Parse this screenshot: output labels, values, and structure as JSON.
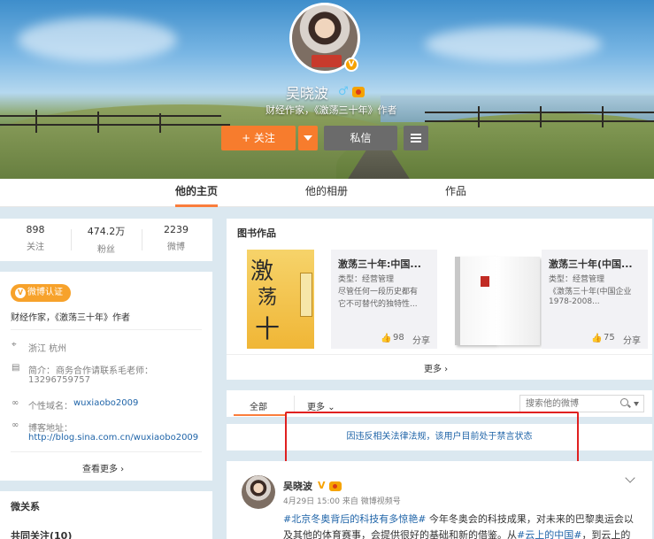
{
  "profile": {
    "name": "吴晓波",
    "description": "财经作家，《激荡三十年》作者",
    "verified_badge": "V",
    "follow_label": "+ 关注",
    "message_label": "私信"
  },
  "tabs": [
    "他的主页",
    "他的相册",
    "作品"
  ],
  "stats": [
    {
      "value": "898",
      "label": "关注"
    },
    {
      "value": "474.2万",
      "label": "粉丝"
    },
    {
      "value": "2239",
      "label": "微博"
    }
  ],
  "verify": {
    "badge_label": "微博认证",
    "text": "财经作家，《激荡三十年》作者"
  },
  "info": {
    "location": "浙江 杭州",
    "intro_label": "简介：",
    "intro_line1": "商务合作请联系毛老师：",
    "intro_line2": "13296759757",
    "domain_label": "个性域名：",
    "domain_value": "wuxiaobo2009",
    "blog_label": "博客地址：",
    "blog_value": "http://blog.sina.com.cn/wuxiaobo2009",
    "more_label": "查看更多 ›"
  },
  "relations": {
    "title": "微关系",
    "common_follow": "共同关注(10)"
  },
  "books": {
    "title": "图书作品",
    "items": [
      {
        "title": "激荡三十年:中国...",
        "type": "类型：经营管理",
        "desc1": "尽管任何一段历史都有",
        "desc2": "它不可替代的独特性...",
        "likes": "98",
        "share": "分享"
      },
      {
        "title": "激荡三十年(中国...",
        "type": "类型：经营管理",
        "desc1": "《激荡三十年(中国企业",
        "desc2": "1978-2008...",
        "likes": "75",
        "share": "分享"
      }
    ],
    "more_label": "更多 ›"
  },
  "feed": {
    "tab_all": "全部",
    "tab_more": "更多",
    "search_placeholder": "搜索他的微博",
    "notice": "因违反相关法律法规，该用户目前处于禁言状态"
  },
  "post": {
    "author": "吴晓波",
    "meta": "4月29日 15:00 来自 微博视频号",
    "line1_tag": "#北京冬奥背后的科技有多惊艳#",
    "line1_text": " 今年冬奥会的科技成果，对未来的巴黎奥运会以",
    "line2_text": "及其他的体育赛事，会提供很好的基础和新的借鉴。从",
    "line2_tag": "#云上的中国#",
    "line2_tail": "，到云上的"
  },
  "colors": {
    "accent": "#f77c2d",
    "link": "#1f64a8",
    "gold": "#f7a22b",
    "highlight": "#e02020"
  }
}
